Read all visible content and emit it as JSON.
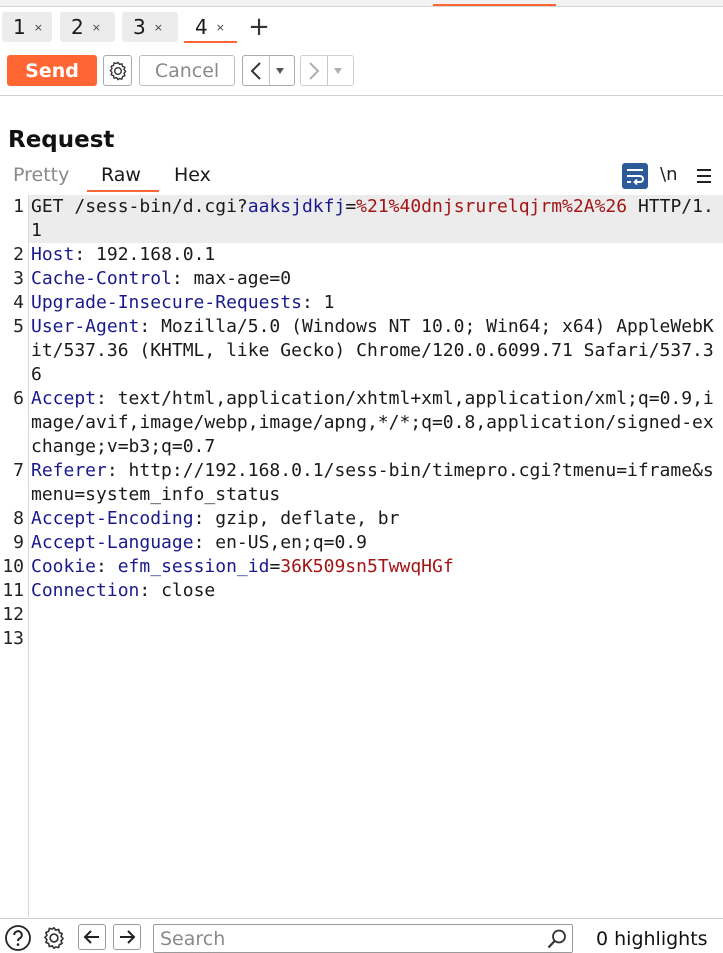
{
  "tabs": [
    {
      "label": "1",
      "close": "×"
    },
    {
      "label": "2",
      "close": "×"
    },
    {
      "label": "3",
      "close": "×"
    },
    {
      "label": "4",
      "close": "×",
      "active": true
    }
  ],
  "tab_add": "+",
  "toolbar": {
    "send_label": "Send",
    "cancel_label": "Cancel",
    "back_label": "<",
    "forward_label": ">",
    "dropdown_glyph": "▾"
  },
  "request": {
    "title": "Request",
    "view_tabs": [
      "Pretty",
      "Raw",
      "Hex"
    ],
    "newline_label": "\\n",
    "line_numbers": [
      "1",
      "2",
      "3",
      "4",
      "5",
      "6",
      "7",
      "8",
      "9",
      "10",
      "11",
      "12",
      "13"
    ],
    "method": "GET",
    "path": "/sess-bin/d.cgi",
    "query_key": "aaksjdkfj",
    "query_value": "%21%40dnjsrurelqjrm%2A%26",
    "protocol": "HTTP/1.1",
    "headers": [
      {
        "name": "Host",
        "value": "192.168.0.1"
      },
      {
        "name": "Cache-Control",
        "value": "max-age=0"
      },
      {
        "name": "Upgrade-Insecure-Requests",
        "value": "1"
      },
      {
        "name": "User-Agent",
        "value": "Mozilla/5.0 (Windows NT 10.0; Win64; x64) AppleWebKit/537.36 (KHTML, like Gecko) Chrome/120.0.6099.71 Safari/537.36"
      },
      {
        "name": "Accept",
        "value": "text/html,application/xhtml+xml,application/xml;q=0.9,image/avif,image/webp,image/apng,*/*;q=0.8,application/signed-exchange;v=b3;q=0.7"
      },
      {
        "name": "Referer",
        "value": "http://192.168.0.1/sess-bin/timepro.cgi?tmenu=iframe&smenu=system_info_status"
      },
      {
        "name": "Accept-Encoding",
        "value": "gzip, deflate, br"
      },
      {
        "name": "Accept-Language",
        "value": "en-US,en;q=0.9"
      },
      {
        "name": "Cookie",
        "value": "",
        "cookie_name": "efm_session_id",
        "cookie_value": "36K509sn5TwwqHGf"
      },
      {
        "name": "Connection",
        "value": "close"
      }
    ]
  },
  "footer": {
    "search_placeholder": "Search",
    "highlights": "0 highlights"
  },
  "icons": {
    "settings": "gear-icon",
    "wrap": "wrap-lines-icon",
    "menu": "hamburger-menu-icon",
    "help": "help-icon",
    "search": "magnifier-icon"
  },
  "colors": {
    "accent": "#ff6633",
    "header_name": "#1a1a8c",
    "param_value": "#a31515",
    "wrap_button": "#2d5b9a"
  }
}
